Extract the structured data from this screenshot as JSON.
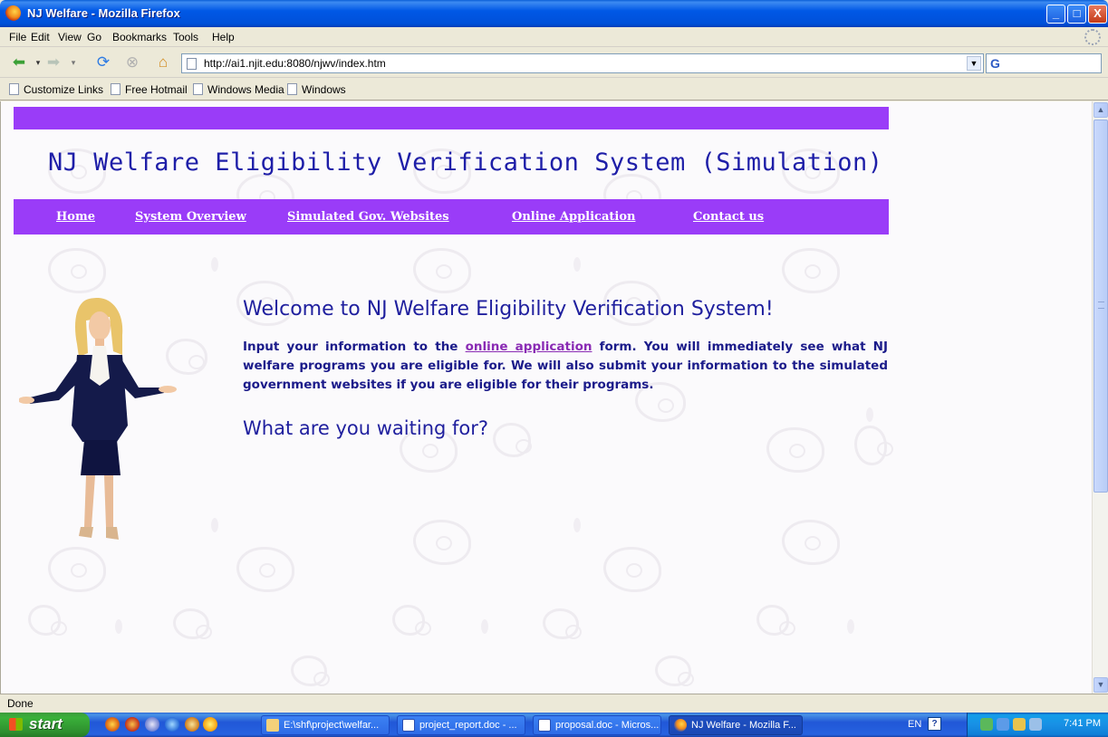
{
  "window": {
    "title": "NJ Welfare - Mozilla Firefox",
    "controls": [
      "_",
      "□",
      "X"
    ]
  },
  "menu": [
    "File",
    "Edit",
    "View",
    "Go",
    "Bookmarks",
    "Tools",
    "Help"
  ],
  "navbar": {
    "url": "http://ai1.njit.edu:8080/njwv/index.htm",
    "search_glyph": "G"
  },
  "bookmarks": [
    "Customize Links",
    "Free Hotmail",
    "Windows Media",
    "Windows"
  ],
  "page": {
    "title": "NJ Welfare Eligibility Verification System (Simulation)",
    "nav": [
      "Home",
      "System Overview",
      "Simulated Gov. Websites",
      "Online Application",
      "Contact us"
    ],
    "welcome": "Welcome to NJ Welfare Eligibility Verification System!",
    "intro_before": "Input your information to the ",
    "intro_link": "online application",
    "intro_after": " form. You will immediately see what NJ welfare programs you are eligible for. We will also submit your information to the simulated government websites if you are eligible for their programs.",
    "waiting": "What are you waiting for?"
  },
  "status": "Done",
  "taskbar": {
    "start": "start",
    "tasks": [
      "E:\\shf\\project\\welfar...",
      "project_report.doc - ...",
      "proposal.doc - Micros...",
      "NJ Welfare - Mozilla F..."
    ],
    "lang": "EN",
    "help": "?",
    "clock": "7:41 PM"
  },
  "colors": {
    "purple_bar": "#9A3CF8",
    "title_blue": "#1E1EA8",
    "link_purple": "#8A2BB4"
  }
}
